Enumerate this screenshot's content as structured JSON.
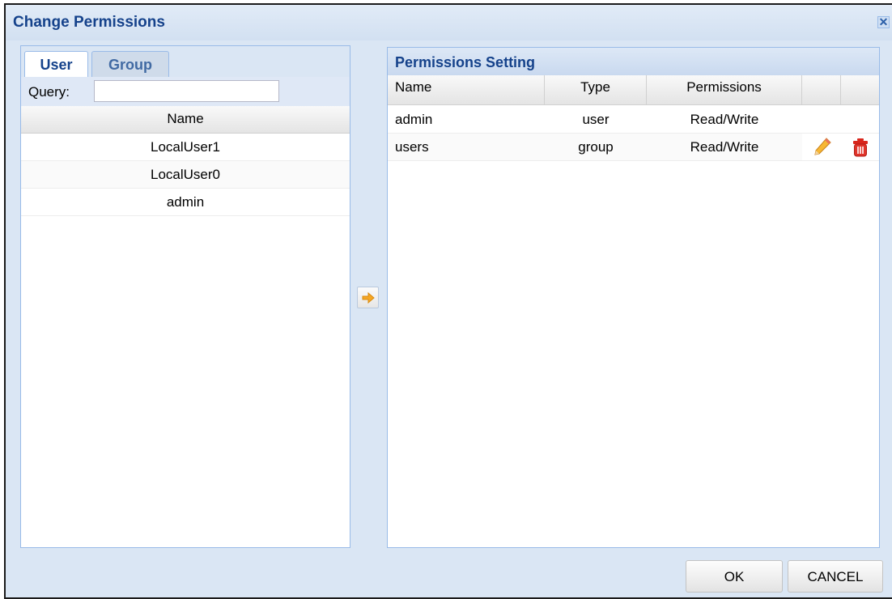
{
  "dialog": {
    "title": "Change Permissions",
    "close_glyph": "✕"
  },
  "left": {
    "tabs": [
      {
        "label": "User",
        "active": true
      },
      {
        "label": "Group",
        "active": false
      }
    ],
    "query_label": "Query:",
    "query_value": "",
    "column_header": "Name",
    "users": [
      "LocalUser1",
      "LocalUser0",
      "admin"
    ]
  },
  "right": {
    "title": "Permissions Setting",
    "columns": {
      "name": "Name",
      "type": "Type",
      "permissions": "Permissions"
    },
    "rows": [
      {
        "name": "admin",
        "type": "user",
        "permissions": "Read/Write"
      },
      {
        "name": "users",
        "type": "group",
        "permissions": "Read/Write"
      }
    ]
  },
  "icons": {
    "add": "arrow-right-icon",
    "edit": "pencil-icon",
    "delete": "trash-icon"
  },
  "colors": {
    "title_text": "#15428b",
    "dialog_bg": "#dae6f4",
    "border": "#99bbe8",
    "arrow": "#f5a623",
    "delete": "#d9261c"
  },
  "footer": {
    "ok_label": "OK",
    "cancel_label": "CANCEL"
  }
}
